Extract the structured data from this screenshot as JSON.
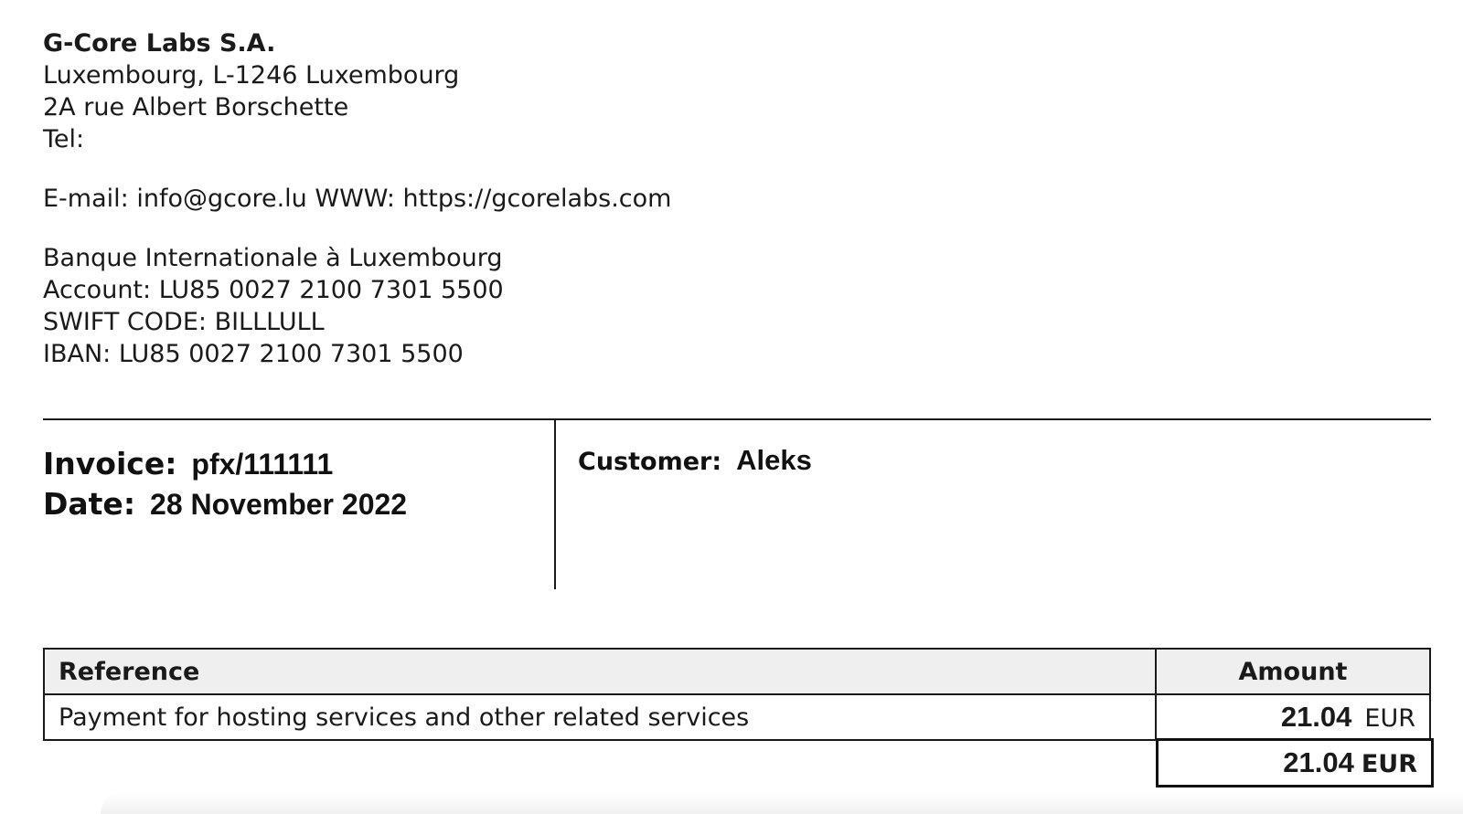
{
  "company": {
    "name": "G-Core Labs S.A.",
    "city_line": "Luxembourg, L-1246 Luxembourg",
    "street": "2A rue Albert Borschette",
    "tel": "Tel:",
    "contact": "E-mail: info@gcore.lu WWW: https://gcorelabs.com"
  },
  "bank": {
    "name": "Banque Internationale à Luxembourg",
    "account": "Account: LU85 0027 2100 7301 5500",
    "swift": "SWIFT CODE: BILLLULL",
    "iban": "IBAN: LU85 0027 2100 7301 5500"
  },
  "invoice": {
    "invoice_label": "Invoice:",
    "invoice_number": "pfx/111111",
    "date_label": "Date:",
    "date_value": "28 November 2022",
    "customer_label": "Customer:",
    "customer_value": "Aleks"
  },
  "table": {
    "headers": {
      "reference": "Reference",
      "amount": "Amount"
    },
    "rows": [
      {
        "reference": "Payment for hosting services and other related services",
        "amount": "21.04",
        "currency": "EUR"
      }
    ],
    "total": {
      "amount": "21.04",
      "currency": "EUR"
    }
  }
}
